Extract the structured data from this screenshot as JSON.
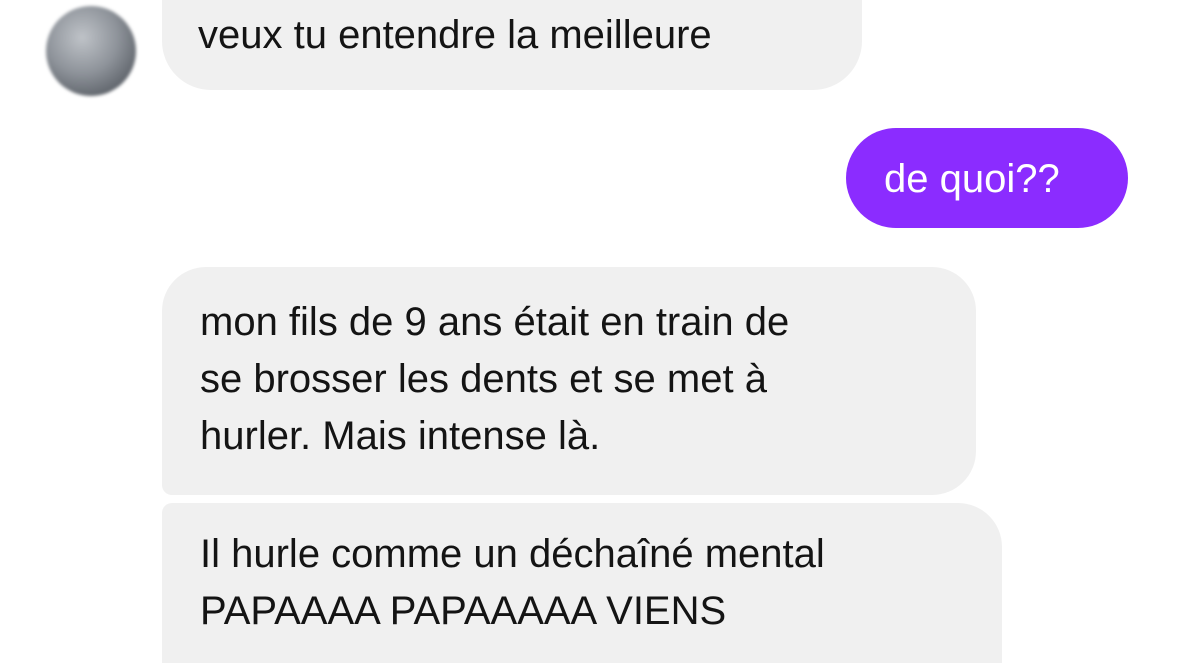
{
  "conversation": {
    "messages": [
      {
        "sender": "other",
        "lines": [
          "veux tu entendre la meilleure"
        ]
      },
      {
        "sender": "self",
        "lines": [
          "de quoi??"
        ]
      },
      {
        "sender": "other",
        "lines": [
          "mon fils de 9 ans était en train de",
          "se brosser les dents et se met à",
          "hurler. Mais intense là."
        ]
      },
      {
        "sender": "other",
        "lines": [
          "Il hurle comme un déchaîné mental",
          "PAPAAAA PAPAAAAA VIENS"
        ]
      }
    ]
  },
  "colors": {
    "incoming_bubble": "#f0f0f0",
    "outgoing_bubble": "#8b2cff",
    "background": "#ffffff"
  }
}
